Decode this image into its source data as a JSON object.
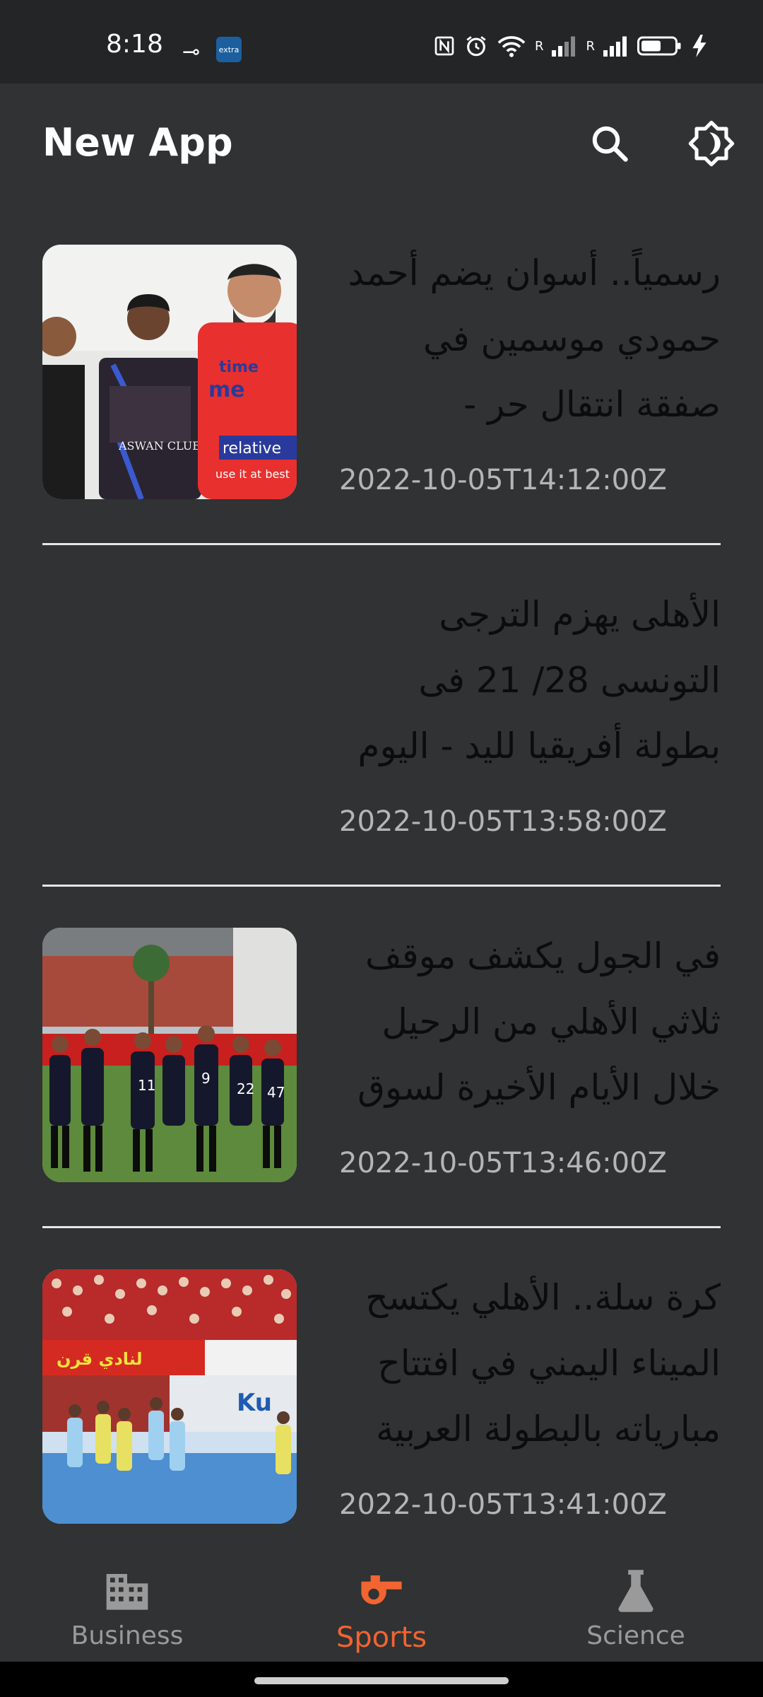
{
  "status_bar": {
    "time": "8:18",
    "app_badge": "extra",
    "signal_label_1": "R",
    "signal_label_2": "R"
  },
  "app_bar": {
    "title": "New App"
  },
  "articles": [
    {
      "title": "رسمياً.. أسوان يضم أحمد حمودي موسمين في صفقة انتقال حر - Yallakora - يلاكورة",
      "time": "2022-10-05T14:12:00Z",
      "has_image": true
    },
    {
      "title": "الأهلى يهزم الترجى التونسى 28/ 21 فى بطولة أفريقيا لليد - اليوم السابع",
      "time": "2022-10-05T13:58:00Z",
      "has_image": false
    },
    {
      "title": "في الجول يكشف موقف ثلاثي الأهلي من الرحيل خلال الأيام الأخيرة لسوق الانتقالات - FilGoal.com",
      "time": "2022-10-05T13:46:00Z",
      "has_image": true
    },
    {
      "title": "كرة سلة.. الأهلي يكتسح الميناء اليمني في افتتاح مبارياته بالبطولة العربية للأندية",
      "time": "2022-10-05T13:41:00Z",
      "has_image": true
    }
  ],
  "bottom_nav": {
    "items": [
      {
        "label": "Business",
        "icon": "business-icon",
        "active": false
      },
      {
        "label": "Sports",
        "icon": "whistle-icon",
        "active": true
      },
      {
        "label": "Science",
        "icon": "flask-icon",
        "active": false
      }
    ]
  },
  "colors": {
    "background": "#303234",
    "status_bar": "#232527",
    "accent": "#f26430",
    "title_text": "#0c0c0c",
    "time_text": "#b5b5b5",
    "nav_inactive": "#9a9a9a"
  }
}
